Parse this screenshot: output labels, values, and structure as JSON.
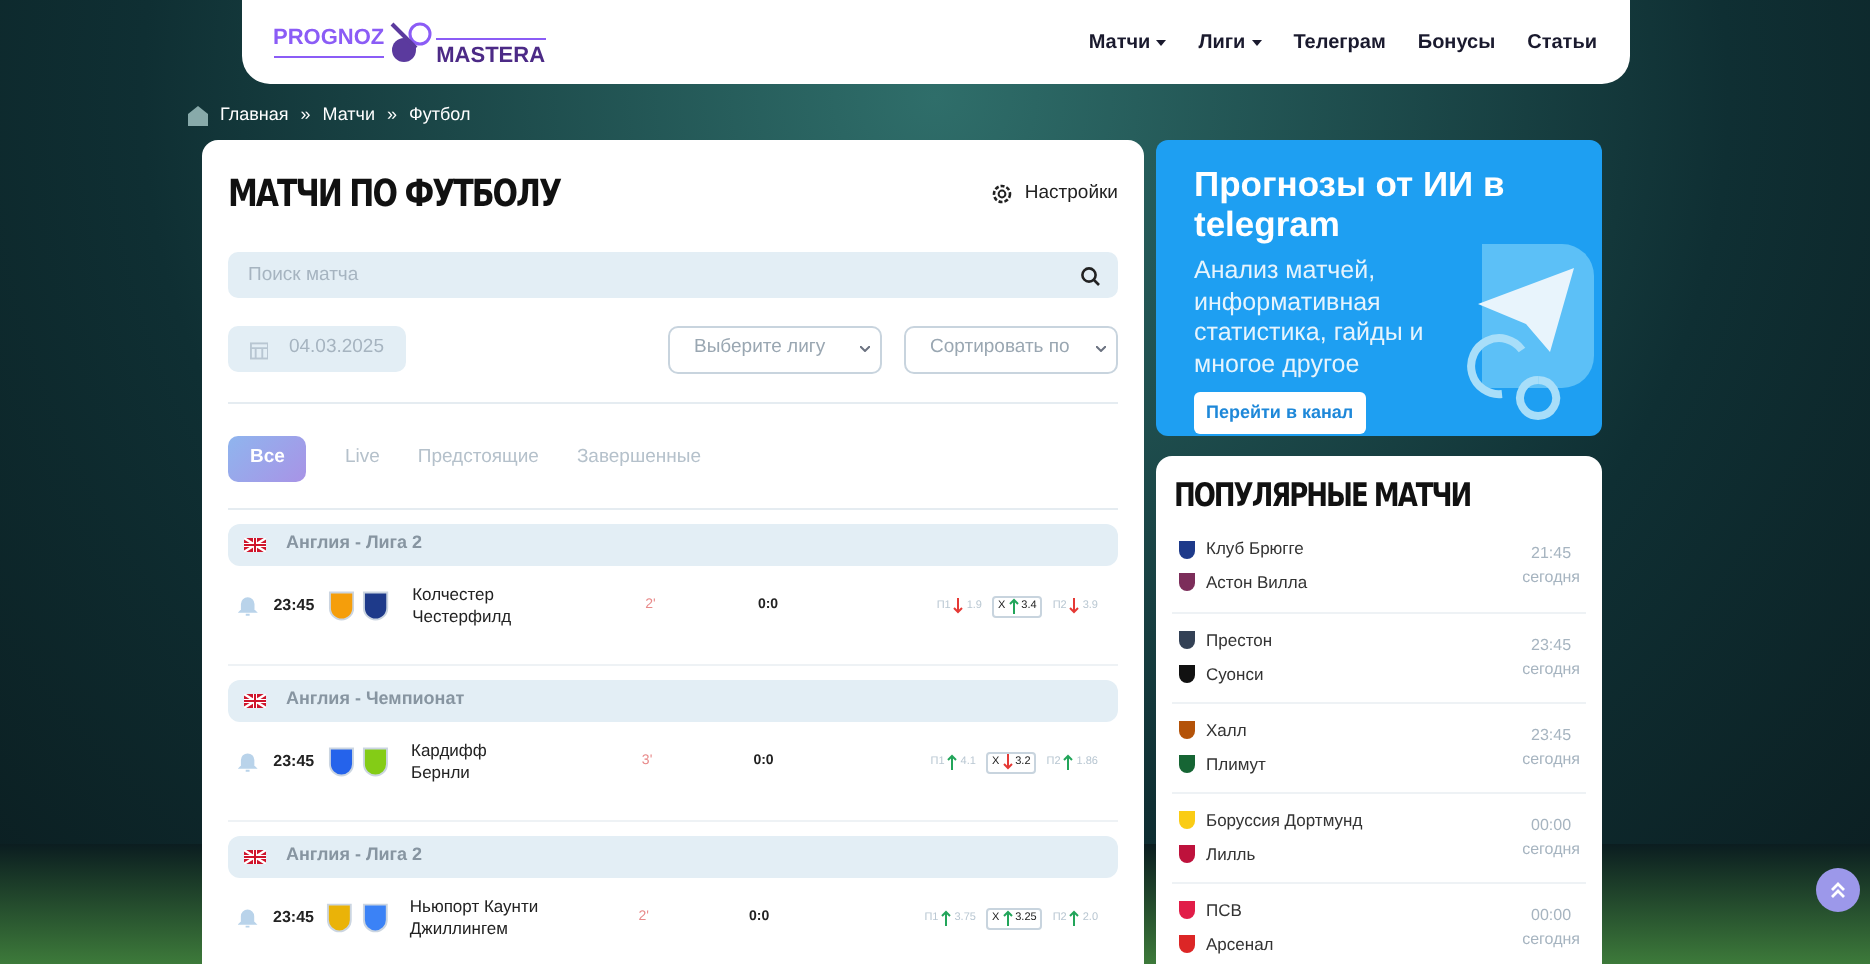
{
  "header": {
    "logo": {
      "top": "PROGNOZ",
      "bottom": "MASTERA"
    },
    "nav": [
      {
        "label": "Матчи",
        "dropdown": true
      },
      {
        "label": "Лиги",
        "dropdown": true
      },
      {
        "label": "Телеграм",
        "dropdown": false
      },
      {
        "label": "Бонусы",
        "dropdown": false
      },
      {
        "label": "Статьи",
        "dropdown": false
      }
    ]
  },
  "breadcrumbs": [
    "Главная",
    "Матчи",
    "Футбол"
  ],
  "breadcrumb_separator": "»",
  "main": {
    "title": "МАТЧИ ПО ФУТБОЛУ",
    "settings": "Настройки",
    "search": {
      "placeholder": "Поиск матча"
    },
    "date": "04.03.2025",
    "league_select": "Выберите лигу",
    "sort_select": "Сортировать по",
    "tabs": [
      {
        "label": "Все",
        "selected": true
      },
      {
        "label": "Live",
        "selected": false
      },
      {
        "label": "Предстоящие",
        "selected": false
      },
      {
        "label": "Завершенные",
        "selected": false
      }
    ],
    "groups": [
      {
        "league": "Англия - Лига 2",
        "matches": [
          {
            "time": "23:45",
            "home": "Колчестер",
            "away": "Честерфилд",
            "minute": "2'",
            "score": "0:0",
            "odds": [
              {
                "label": "П1",
                "rising": false,
                "value": "1.9",
                "boxed": false
              },
              {
                "label": "X",
                "rising": true,
                "value": "3.4",
                "boxed": true
              },
              {
                "label": "П2",
                "rising": false,
                "value": "3.9",
                "boxed": false
              }
            ]
          }
        ]
      },
      {
        "league": "Англия - Чемпионат",
        "matches": [
          {
            "time": "23:45",
            "home": "Кардифф",
            "away": "Бернли",
            "minute": "3'",
            "score": "0:0",
            "odds": [
              {
                "label": "П1",
                "rising": true,
                "value": "4.1",
                "boxed": false
              },
              {
                "label": "X",
                "rising": false,
                "value": "3.2",
                "boxed": true
              },
              {
                "label": "П2",
                "rising": true,
                "value": "1.86",
                "boxed": false
              }
            ]
          }
        ]
      },
      {
        "league": "Англия - Лига 2",
        "matches": [
          {
            "time": "23:45",
            "home": "Ньюпорт Каунти",
            "away": "Джиллингем",
            "minute": "2'",
            "score": "0:0",
            "odds": [
              {
                "label": "П1",
                "rising": true,
                "value": "3.75",
                "boxed": false
              },
              {
                "label": "X",
                "rising": true,
                "value": "3.25",
                "boxed": true
              },
              {
                "label": "П2",
                "rising": true,
                "value": "2.0",
                "boxed": false
              }
            ]
          }
        ]
      }
    ]
  },
  "promo": {
    "title": "Прогнозы от ИИ в telegram",
    "text": "Анализ матчей, информативная статистика, гайды и многое другое",
    "button": "Перейти в канал"
  },
  "popular": {
    "title": "ПОПУЛЯРНЫЕ МАТЧИ",
    "matches": [
      {
        "home": "Клуб Брюгге",
        "away": "Астон Вилла",
        "time": "21:45",
        "day": "сегодня"
      },
      {
        "home": "Престон",
        "away": "Суонси",
        "time": "23:45",
        "day": "сегодня"
      },
      {
        "home": "Халл",
        "away": "Плимут",
        "time": "23:45",
        "day": "сегодня"
      },
      {
        "home": "Боруссия Дортмунд",
        "away": "Лилль",
        "time": "00:00",
        "day": "сегодня"
      },
      {
        "home": "ПСВ",
        "away": "Арсенал",
        "time": "00:00",
        "day": "сегодня"
      }
    ]
  }
}
